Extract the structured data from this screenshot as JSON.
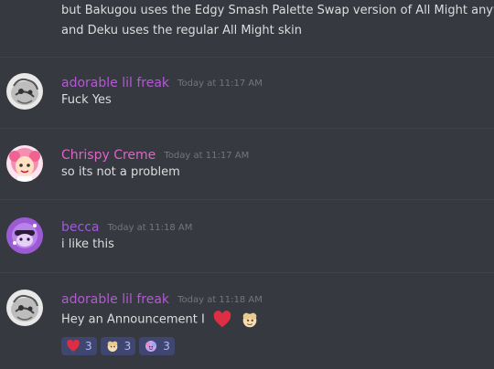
{
  "continuation": {
    "lines": [
      "but Bakugou uses the Edgy Smash Palette Swap version of All Might anyway",
      "and Deku uses the regular All Might skin"
    ]
  },
  "messages": [
    {
      "username": "adorable lil freak",
      "username_color": "#b458d6",
      "timestamp": "Today at 11:17 AM",
      "text": "Fuck Yes",
      "avatar_icon": "grey-creature-avatar-icon"
    },
    {
      "username": "Chrispy Creme",
      "username_color": "#e063c9",
      "timestamp": "Today at 11:17 AM",
      "text": "so its not a problem",
      "avatar_icon": "pink-hair-avatar-icon"
    },
    {
      "username": "becca",
      "username_color": "#9f5bd8",
      "timestamp": "Today at 11:18 AM",
      "text": "i like this",
      "avatar_icon": "purple-character-avatar-icon"
    },
    {
      "username": "adorable lil freak",
      "username_color": "#b458d6",
      "timestamp": "Today at 11:18 AM",
      "text": "Hey an Announcement I",
      "avatar_icon": "grey-creature-avatar-icon",
      "inline_emojis": [
        "heart-icon",
        "custom-cream-emoji-icon"
      ],
      "reactions": [
        {
          "icon": "heart-icon",
          "count": "3"
        },
        {
          "icon": "custom-cream-emoji-icon",
          "count": "3"
        },
        {
          "icon": "custom-purple-emoji-icon",
          "count": "3"
        }
      ]
    }
  ],
  "colors": {
    "background": "#36393f",
    "text": "#dcddde",
    "timestamp": "#72767d",
    "reaction_bg": "#3f4670",
    "reaction_count": "#b9bbf5",
    "heart": "#dd2e44"
  }
}
